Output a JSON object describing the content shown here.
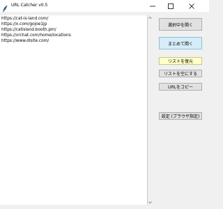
{
  "window": {
    "title": "URL Catcher v0.5",
    "controls": {
      "minimize": "—",
      "maximize": "☐",
      "close": "✕"
    }
  },
  "list": {
    "items": [
      "https://cat-is-land.com/",
      "https://x.com/gojoe1jp",
      "https://catisland.booth.pm/",
      "https://vrchat.com/home/locations",
      "https://www.dlsite.com/"
    ]
  },
  "buttons": {
    "open_selected": "選択中を開く",
    "open_all": "まとめて開く",
    "restore_list": "リストを復元",
    "clear_list": "リストを空にする",
    "copy_urls": "URLをコピー",
    "settings": "設定 (ブラウザ指定)"
  },
  "colors": {
    "open_all_bg": "#d4edf9",
    "restore_bg": "#ffffc6",
    "default_button_bg": "#e1e1e1"
  }
}
